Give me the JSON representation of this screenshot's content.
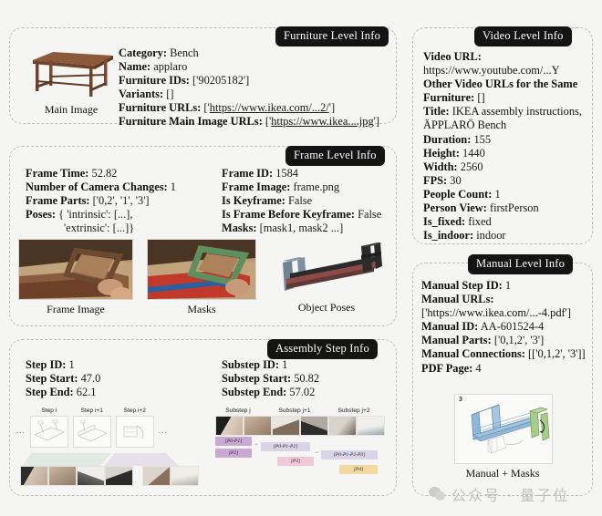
{
  "panels": {
    "furniture": {
      "title": "Furniture Level Info",
      "image_caption": "Main Image",
      "fields": [
        {
          "key": "Category:",
          "value": "Bench"
        },
        {
          "key": "Name:",
          "value": "applaro"
        },
        {
          "key": "Furniture IDs:",
          "value": "['90205182']"
        },
        {
          "key": "Variants:",
          "value": "[]"
        },
        {
          "key": "Furniture URLs:",
          "value": "['https://www.ikea.com/...2/']",
          "link": "https://www.ikea.com/...2/"
        },
        {
          "key": "Furniture Main Image URLs:",
          "value": "['https://www.ikea....jpg']",
          "link": "https://www.ikea....jpg"
        }
      ]
    },
    "frame": {
      "title": "Frame Level Info",
      "left_fields": [
        {
          "key": "Frame Time:",
          "value": "52.82"
        },
        {
          "key": "Number of Camera Changes:",
          "value": "1"
        },
        {
          "key": "Frame Parts:",
          "value": "['0,2', '1', '3']"
        },
        {
          "key": "Poses:",
          "value": "{ 'intrinsic': [...],"
        },
        {
          "key": "",
          "value": "'extrinsic': [...]}"
        }
      ],
      "right_fields": [
        {
          "key": "Frame ID:",
          "value": "1584"
        },
        {
          "key": "Frame Image:",
          "value": "frame.png"
        },
        {
          "key": "Is Keyframe:",
          "value": "False"
        },
        {
          "key": "Is Frame Before Keyframe:",
          "value": "False"
        },
        {
          "key": "Masks:",
          "value": "[mask1, mask2 ...]"
        }
      ],
      "captions": [
        "Frame Image",
        "Masks",
        "Object Poses"
      ]
    },
    "assembly": {
      "title": "Assembly Step Info",
      "left_fields": [
        {
          "key": "Step ID:",
          "value": "1"
        },
        {
          "key": "Step Start:",
          "value": "47.0"
        },
        {
          "key": "Step End:",
          "value": "62.1"
        }
      ],
      "right_fields": [
        {
          "key": "Substep ID:",
          "value": "1"
        },
        {
          "key": "Substep Start:",
          "value": "50.82"
        },
        {
          "key": "Substep End:",
          "value": "57.02"
        }
      ],
      "step_labels": [
        "Step i",
        "Step i+1",
        "Step i+2"
      ],
      "substep_labels": [
        "Substep j",
        "Substep j+1",
        "Substep j+2"
      ],
      "part_tags": [
        "[P0-P1]",
        "[P2]",
        "[P0-P1-P2]",
        "[P3]",
        "[P0-P1-P2-P3]",
        "[P4]"
      ],
      "ellipsis": "..."
    },
    "video": {
      "title": "Video Level Info",
      "fields": [
        {
          "key": "Video URL:",
          "value": "https://www.youtube.com/...Y",
          "link": "https://www.youtube.com/...Y"
        },
        {
          "key": "Other Video URLs for the Same Furniture:",
          "value": "[]"
        },
        {
          "key": "Title:",
          "value": "IKEA assembly instructions, ÄPPLARÖ Bench"
        },
        {
          "key": "Duration:",
          "value": "155"
        },
        {
          "key": "Height:",
          "value": "1440"
        },
        {
          "key": "Width:",
          "value": "2560"
        },
        {
          "key": "FPS:",
          "value": "30"
        },
        {
          "key": "People Count:",
          "value": "1"
        },
        {
          "key": "Person View:",
          "value": "firstPerson"
        },
        {
          "key": "Is_fixed:",
          "value": "fixed"
        },
        {
          "key": "Is_indoor:",
          "value": "indoor"
        }
      ]
    },
    "manual": {
      "title": "Manual Level Info",
      "fields": [
        {
          "key": "Manual Step ID:",
          "value": "1"
        },
        {
          "key": "Manual URLs:",
          "value": "['https://www.ikea.com/...-4.pdf']",
          "link": "https://www.ikea.com/...-4.pdf"
        },
        {
          "key": "Manual ID:",
          "value": "AA-601524-4"
        },
        {
          "key": "Manual Parts:",
          "value": "['0,1,2', '3']"
        },
        {
          "key": "Manual Connections:",
          "value": "[['0,1,2', '3']]"
        },
        {
          "key": "PDF Page:",
          "value": "4"
        }
      ],
      "image_caption": "Manual + Masks",
      "image_step_number": "3"
    }
  },
  "watermark": {
    "icon": "wechat-icon",
    "text": "公众号 · 量子位"
  },
  "colors": {
    "background": "#f5f5f4",
    "badge_bg": "#141414",
    "badge_text": "#ffffff",
    "panel_border": "#bdbdbd",
    "mask_green": "#5e8f5e",
    "mask_red": "#c0392b",
    "mask_blue": "#2c5f9e",
    "pose_blue": "#6f8391",
    "pose_dark": "#2b2b2b",
    "pose_red": "#8e4a46",
    "manual_blue": "#8fb8d8",
    "manual_green": "#a8cc8c",
    "tag_purple": "#c9a8d4",
    "tag_lavender": "#d9d4e8",
    "tag_pink": "#f0c8d8",
    "tag_yellow": "#f2d9a0"
  }
}
